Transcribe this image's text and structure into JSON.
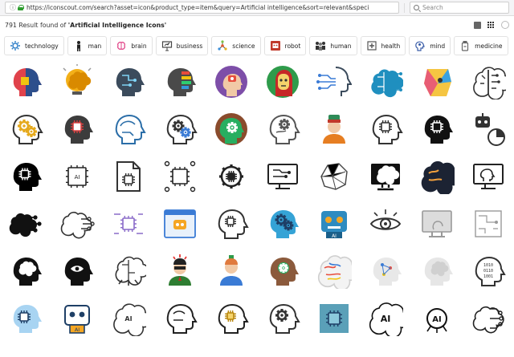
{
  "browser": {
    "url": "https://iconscout.com/search?asset=icon&product_type=item&query=Artificial intelligence&sort=relevant&speci",
    "search_placeholder": "Search"
  },
  "results": {
    "count": "791",
    "prefix": "Result found of",
    "query": "'Artificial Intelligence Icons'"
  },
  "tags": [
    {
      "label": "technology",
      "icon": "gear-brain-icon",
      "color": "#2f7fc8"
    },
    {
      "label": "man",
      "icon": "person-icon",
      "color": "#222222"
    },
    {
      "label": "brain",
      "icon": "brain-icon",
      "color": "#e24a8b"
    },
    {
      "label": "business",
      "icon": "presentation-icon",
      "color": "#444444"
    },
    {
      "label": "science",
      "icon": "molecule-icon",
      "color": "#e05a2b"
    },
    {
      "label": "robot",
      "icon": "robot-icon",
      "color": "#c0392b"
    },
    {
      "label": "human",
      "icon": "people-icon",
      "color": "#333333"
    },
    {
      "label": "health",
      "icon": "medical-icon",
      "color": "#555555"
    },
    {
      "label": "mind",
      "icon": "head-mind-icon",
      "color": "#3a5da8"
    },
    {
      "label": "medicine",
      "icon": "pill-bottle-icon",
      "color": "#666666"
    }
  ],
  "grid_rows": [
    [
      "ai-head-color-icon",
      "ai-brain-bulb-icon",
      "ai-head-circuit-icon",
      "ai-head-colors-icon",
      "ai-robot-face-purple-icon",
      "ai-robot-girl-icon",
      "ai-head-lines-icon",
      "ai-brain-teal-icon",
      "ai-face-colorful-icon",
      "ai-brain-half-icon"
    ],
    [
      "ai-head-gear-yellow-icon",
      "ai-chip-head-icon",
      "ai-head-blue-outline-icon",
      "ai-head-gears-icon",
      "ai-head-green-circle-icon",
      "ai-head-sketch-icon",
      "ai-robot-person-icon",
      "ai-chip-head-outline-icon",
      "ai-chip-head-black-icon",
      "ai-robot-chart-icon"
    ],
    [
      "ai-chip-head-solid-icon",
      "ai-chip-outline-icon",
      "ai-document-chip-icon",
      "ai-processor-icon",
      "ai-gear-chip-icon",
      "ai-monitor-circuit-icon",
      "ai-polygon-brain-icon",
      "ai-monitor-brain-icon",
      "ai-brain-dark-icon",
      "ai-monitor-head-icon"
    ],
    [
      "ai-brain-network-icon",
      "ai-brain-lines-icon",
      "ai-circuit-purple-icon",
      "ai-browser-robot-icon",
      "ai-head-chip-icon",
      "ai-head-blue-gear-icon",
      "ai-robot-blue-icon",
      "ai-eye-icon",
      "ai-monitor-gray-icon",
      "ai-circuit-pattern-icon"
    ],
    [
      "ai-head-brain-icon",
      "ai-head-eye-icon",
      "ai-brain-cloud-icon",
      "ai-man-mind-icon",
      "ai-person-icon",
      "ai-head-dark-skin-icon",
      "ai-brain-color-icon",
      "ai-head-network-icon",
      "ai-head-molecule-icon",
      "ai-head-binary-icon"
    ],
    [
      "ai-chip-blue-head-icon",
      "ai-robot-ai-icon",
      "ai-ai-brain-icon",
      "ai-head-outline-icon",
      "ai-head-square-icon",
      "ai-gear-head-icon",
      "ai-chip-square-icon",
      "ai-ai-text-icon",
      "ai-ai-text-outline-icon",
      "ai-brain-circuit-icon"
    ]
  ]
}
